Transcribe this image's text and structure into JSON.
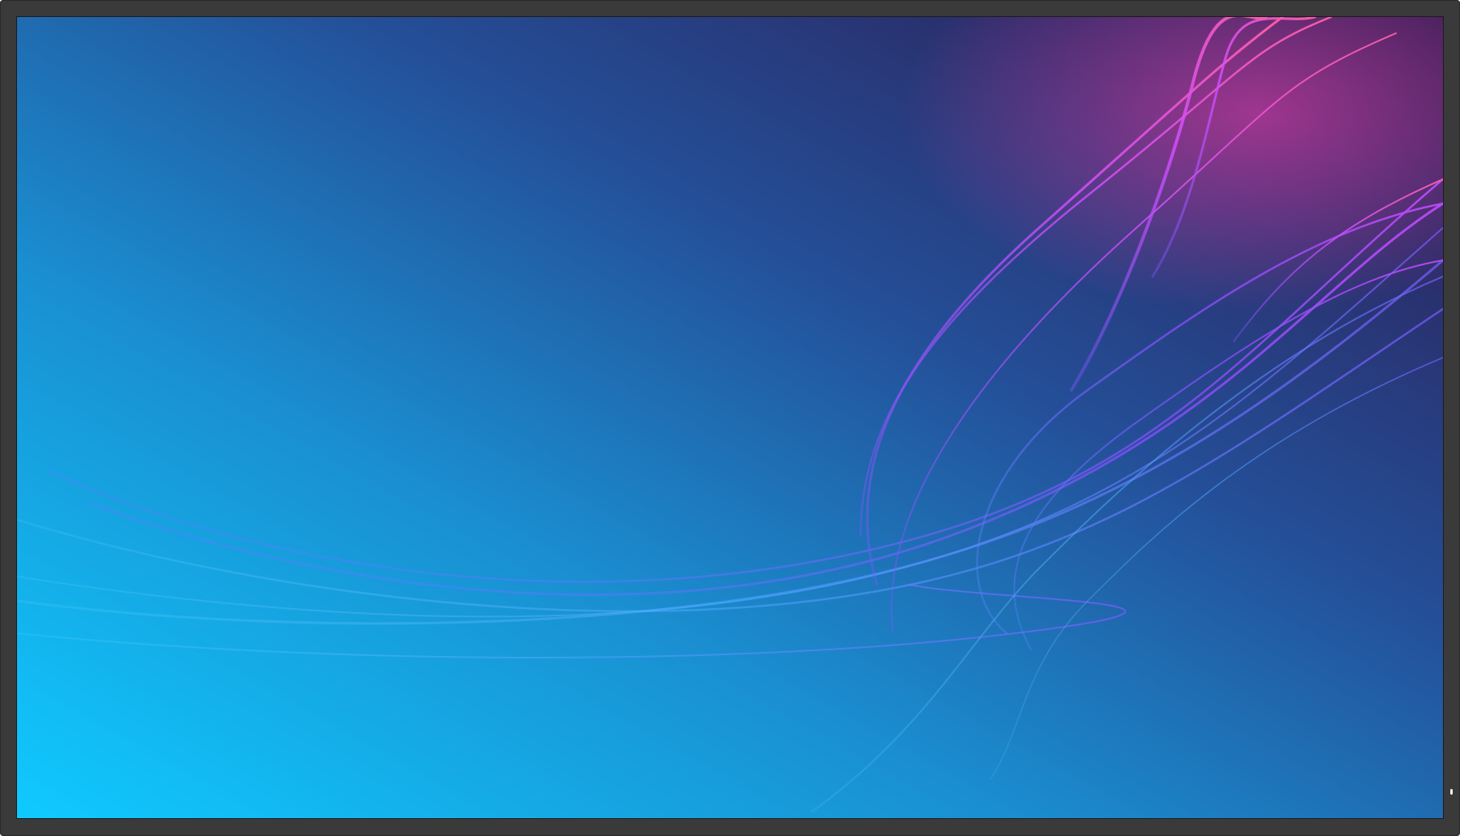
{
  "display": {
    "bezel_color": "#3a3a3a",
    "power_indicator_color": "#f2f2f2"
  },
  "wallpaper": {
    "style": "abstract flowing light waves",
    "gradient_colors": [
      "#10c8ff",
      "#1c7fc0",
      "#24397a",
      "#2a1f55"
    ],
    "wave_colors": [
      "#3aa6ff",
      "#5d6bff",
      "#8b3dff",
      "#e84aff",
      "#ff4f9a"
    ]
  }
}
